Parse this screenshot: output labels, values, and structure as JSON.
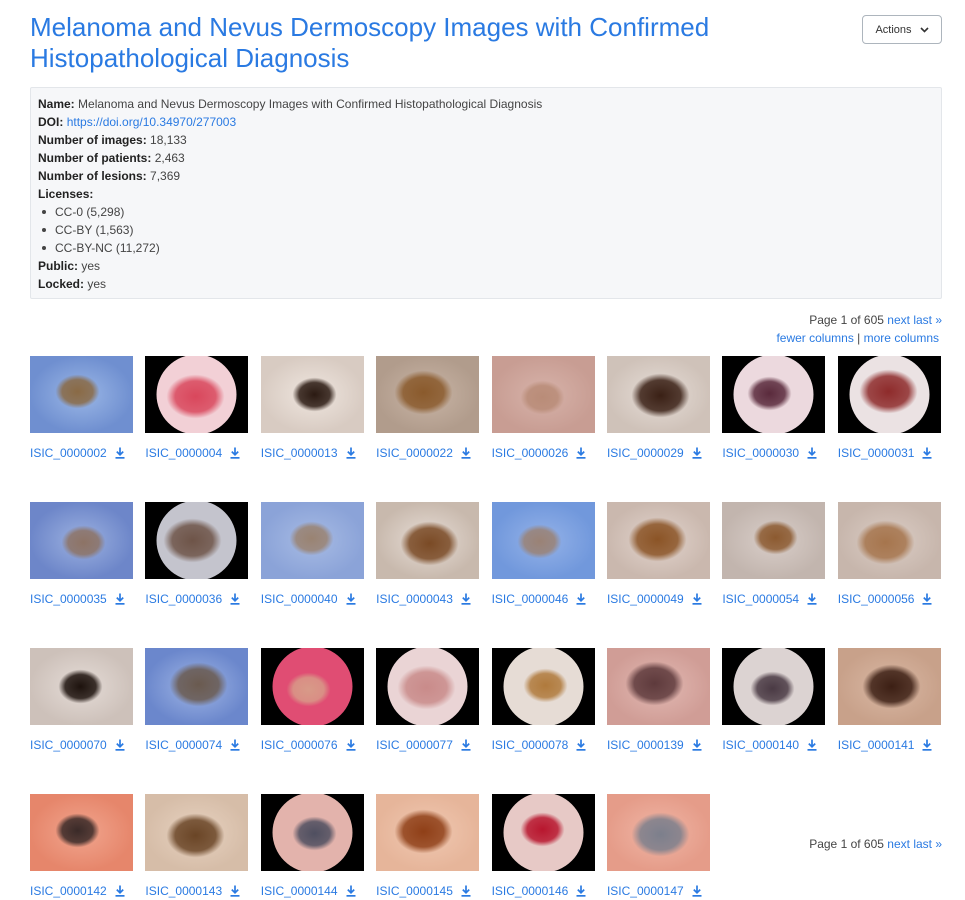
{
  "title": "Melanoma and Nevus Dermoscopy Images with Confirmed Histopathological Diagnosis",
  "actions_label": "Actions",
  "info": {
    "name_label": "Name:",
    "name_value": "Melanoma and Nevus Dermoscopy Images with Confirmed Histopathological Diagnosis",
    "doi_label": "DOI:",
    "doi_value": "https://doi.org/10.34970/277003",
    "images_label": "Number of images:",
    "images_value": "18,133",
    "patients_label": "Number of patients:",
    "patients_value": "2,463",
    "lesions_label": "Number of lesions:",
    "lesions_value": "7,369",
    "licenses_label": "Licenses:",
    "licenses": [
      "CC-0 (5,298)",
      "CC-BY (1,563)",
      "CC-BY-NC (11,272)"
    ],
    "public_label": "Public:",
    "public_value": "yes",
    "locked_label": "Locked:",
    "locked_value": "yes"
  },
  "pager": {
    "text": "Page 1 of 605",
    "next": "next",
    "last": "last »"
  },
  "columns": {
    "fewer": "fewer columns",
    "sep": "|",
    "more": "more columns"
  },
  "colors": {
    "link": "#2a7ae2"
  },
  "icons": {
    "download": "download-icon",
    "actions_caret": "chevron-down-icon"
  },
  "images": [
    {
      "id": "ISIC_0000002",
      "bg": "#9bb7e6",
      "bg2": "#6f8fd0",
      "lesion": "#8a6a45",
      "circle": false
    },
    {
      "id": "ISIC_0000004",
      "bg": "#f2d0d6",
      "bg2": "#000000",
      "lesion": "#d9475c",
      "circle": true
    },
    {
      "id": "ISIC_0000013",
      "bg": "#efe6df",
      "bg2": "#d8cbc2",
      "lesion": "#2b1a12",
      "circle": false
    },
    {
      "id": "ISIC_0000022",
      "bg": "#c9b5a6",
      "bg2": "#b19c8c",
      "lesion": "#8a5a2c",
      "circle": false
    },
    {
      "id": "ISIC_0000026",
      "bg": "#d7b3aa",
      "bg2": "#c89d93",
      "lesion": "#b98c78",
      "circle": false
    },
    {
      "id": "ISIC_0000029",
      "bg": "#e6ddd7",
      "bg2": "#cfc2b9",
      "lesion": "#3a2015",
      "circle": false
    },
    {
      "id": "ISIC_0000030",
      "bg": "#ecd9de",
      "bg2": "#000000",
      "lesion": "#5a2a3c",
      "circle": true
    },
    {
      "id": "ISIC_0000031",
      "bg": "#ebe2e3",
      "bg2": "#000000",
      "lesion": "#8e2b2b",
      "circle": true
    },
    {
      "id": "ISIC_0000035",
      "bg": "#9cb1e0",
      "bg2": "#6d86c9",
      "lesion": "#8d7365",
      "circle": false
    },
    {
      "id": "ISIC_0000036",
      "bg": "#c4c4cd",
      "bg2": "#000000",
      "lesion": "#6e5448",
      "circle": true
    },
    {
      "id": "ISIC_0000040",
      "bg": "#a7bbe4",
      "bg2": "#8ba3d8",
      "lesion": "#9a8372",
      "circle": false
    },
    {
      "id": "ISIC_0000043",
      "bg": "#e7ddd6",
      "bg2": "#c8b9ad",
      "lesion": "#7a4a25",
      "circle": false
    },
    {
      "id": "ISIC_0000046",
      "bg": "#94b2e8",
      "bg2": "#7198dc",
      "lesion": "#9a8275",
      "circle": false
    },
    {
      "id": "ISIC_0000049",
      "bg": "#e2d4cd",
      "bg2": "#cab8ae",
      "lesion": "#8b5426",
      "circle": false
    },
    {
      "id": "ISIC_0000054",
      "bg": "#d9cec9",
      "bg2": "#c2b5ae",
      "lesion": "#8c5a30",
      "circle": false
    },
    {
      "id": "ISIC_0000056",
      "bg": "#dbcdc5",
      "bg2": "#c7b6ac",
      "lesion": "#a6754d",
      "circle": false
    },
    {
      "id": "ISIC_0000070",
      "bg": "#e5dcd7",
      "bg2": "#cdc1ba",
      "lesion": "#1d120d",
      "circle": false
    },
    {
      "id": "ISIC_0000074",
      "bg": "#9fb5e5",
      "bg2": "#6b87cc",
      "lesion": "#6a5a4f",
      "circle": false
    },
    {
      "id": "ISIC_0000076",
      "bg": "#e04d73",
      "bg2": "#000000",
      "lesion": "#d89a88",
      "circle": true
    },
    {
      "id": "ISIC_0000077",
      "bg": "#ead4d5",
      "bg2": "#000000",
      "lesion": "#c98b8a",
      "circle": true
    },
    {
      "id": "ISIC_0000078",
      "bg": "#e6dcd5",
      "bg2": "#000000",
      "lesion": "#b07a3c",
      "circle": true
    },
    {
      "id": "ISIC_0000139",
      "bg": "#e2b9b3",
      "bg2": "#d09d96",
      "lesion": "#5e3a3c",
      "circle": false
    },
    {
      "id": "ISIC_0000140",
      "bg": "#dcd3d2",
      "bg2": "#000000",
      "lesion": "#4a3a44",
      "circle": true
    },
    {
      "id": "ISIC_0000141",
      "bg": "#d9b8a4",
      "bg2": "#c8a18a",
      "lesion": "#3c1f14",
      "circle": false
    },
    {
      "id": "ISIC_0000142",
      "bg": "#f1a58e",
      "bg2": "#e6866b",
      "lesion": "#3a2a28",
      "circle": false
    },
    {
      "id": "ISIC_0000143",
      "bg": "#e7d2c0",
      "bg2": "#d6bda8",
      "lesion": "#6a4526",
      "circle": false
    },
    {
      "id": "ISIC_0000144",
      "bg": "#e3b3ac",
      "bg2": "#000000",
      "lesion": "#4f4f60",
      "circle": true
    },
    {
      "id": "ISIC_0000145",
      "bg": "#f0c8b1",
      "bg2": "#e6b59a",
      "lesion": "#8f3f17",
      "circle": false
    },
    {
      "id": "ISIC_0000146",
      "bg": "#e7c9c6",
      "bg2": "#000000",
      "lesion": "#b8162e",
      "circle": true
    },
    {
      "id": "ISIC_0000147",
      "bg": "#f0b6a6",
      "bg2": "#e59c89",
      "lesion": "#7c7f8c",
      "circle": false
    }
  ]
}
